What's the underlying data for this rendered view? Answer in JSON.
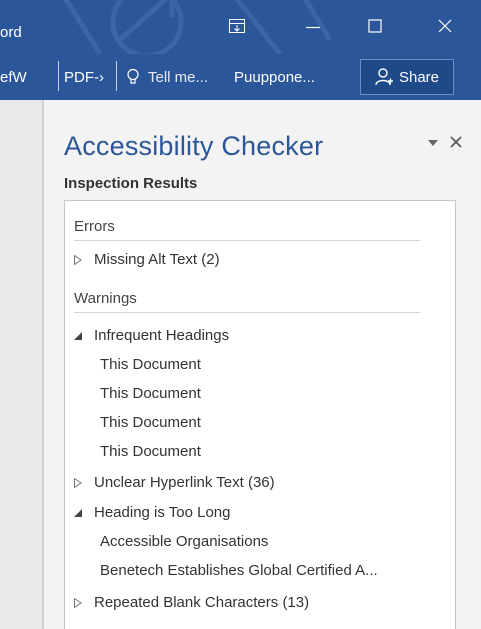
{
  "window": {
    "app_name": "ord",
    "controls": {
      "ribbon_display_icon": "ribbon-display-options-icon",
      "minimize_icon": "minimize-icon",
      "maximize_icon": "maximize-icon",
      "close_icon": "close-icon"
    }
  },
  "ribbon": {
    "item1": "efW",
    "item2": "PDF-›",
    "tell_me": "Tell me...",
    "user": "Puuppone...",
    "share": "Share"
  },
  "pane": {
    "title": "Accessibility Checker",
    "subtitle": "Inspection Results",
    "sections": [
      {
        "heading": "Errors",
        "groups": [
          {
            "label": "Missing Alt Text (2)",
            "expanded": false,
            "children": []
          }
        ]
      },
      {
        "heading": "Warnings",
        "groups": [
          {
            "label": "Infrequent Headings",
            "expanded": true,
            "children": [
              "This Document",
              "This Document",
              "This Document",
              "This Document"
            ]
          },
          {
            "label": "Unclear Hyperlink Text (36)",
            "expanded": false,
            "children": []
          },
          {
            "label": "Heading is Too Long",
            "expanded": true,
            "children": [
              "Accessible Organisations",
              "Benetech Establishes Global Certified A..."
            ]
          },
          {
            "label": "Repeated Blank Characters (13)",
            "expanded": false,
            "children": []
          }
        ]
      }
    ]
  },
  "colors": {
    "accent": "#2b579a",
    "pane_bg": "#f3f3f3",
    "list_bg": "#ffffff"
  }
}
